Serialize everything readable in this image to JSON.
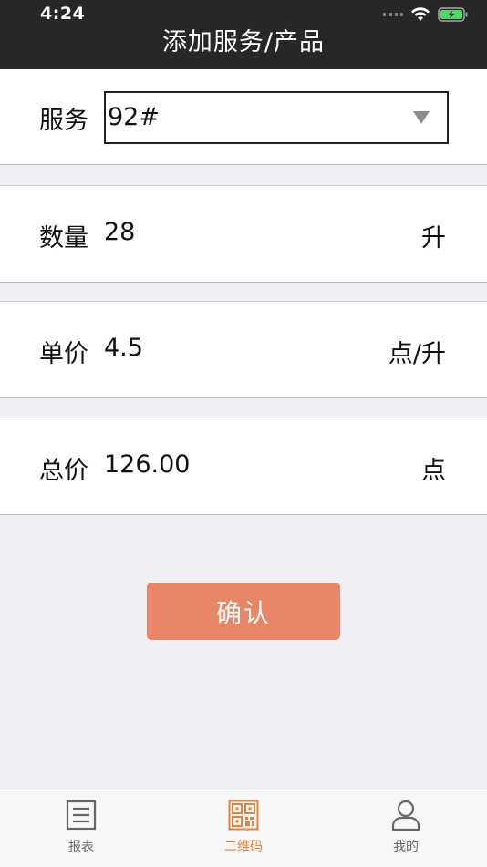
{
  "status_bar": {
    "time": "4:24"
  },
  "nav": {
    "title": "添加服务/产品"
  },
  "service": {
    "label": "服务",
    "selected": "92#"
  },
  "quantity": {
    "label": "数量",
    "value": "28",
    "unit": "升"
  },
  "unit_price": {
    "label": "单价",
    "value": "4.5",
    "unit": "点/升"
  },
  "total": {
    "label": "总价",
    "value": "126.00",
    "unit": "点"
  },
  "confirm_label": "确认",
  "tabs": [
    {
      "label": "报表",
      "icon": "report-list-icon",
      "active": false
    },
    {
      "label": "二维码",
      "icon": "qr-code-icon",
      "active": true
    },
    {
      "label": "我的",
      "icon": "user-icon",
      "active": false
    }
  ],
  "colors": {
    "nav_bg": "#272727",
    "accent": "#e9813d",
    "button": "#e88566",
    "page_bg": "#efeff4"
  }
}
